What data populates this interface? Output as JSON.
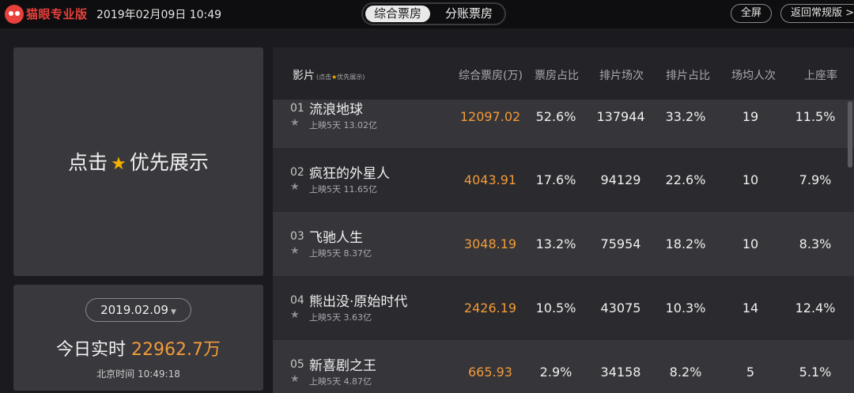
{
  "header": {
    "brand": "猫眼专业版",
    "datetime": "2019年02月09日 10:49",
    "tabs": [
      "综合票房",
      "分账票房"
    ],
    "fullscreen_label": "全屏",
    "return_label": "返回常规版 >"
  },
  "promo": {
    "text_before": "点击",
    "text_after": "优先展示"
  },
  "today": {
    "date": "2019.02.09",
    "label": "今日实时",
    "value": "22962.7万",
    "beijing_time": "北京时间 10:49:18"
  },
  "table": {
    "columns": {
      "film": "影片",
      "film_note_before": "(点击",
      "film_note_after": "优先展示)",
      "box_office": "综合票房(万)",
      "box_ratio": "票房占比",
      "shows": "排片场次",
      "show_ratio": "排片占比",
      "avg_people": "场均人次",
      "seat_rate": "上座率"
    },
    "rows": [
      {
        "rank": "01",
        "title": "流浪地球",
        "days": "上映5天",
        "total": "13.02亿",
        "box": "12097.02",
        "box_ratio": "52.6%",
        "shows": "137944",
        "show_ratio": "33.2%",
        "avg": "19",
        "seat": "11.5%"
      },
      {
        "rank": "02",
        "title": "疯狂的外星人",
        "days": "上映5天",
        "total": "11.65亿",
        "box": "4043.91",
        "box_ratio": "17.6%",
        "shows": "94129",
        "show_ratio": "22.6%",
        "avg": "10",
        "seat": "7.9%"
      },
      {
        "rank": "03",
        "title": "飞驰人生",
        "days": "上映5天",
        "total": "8.37亿",
        "box": "3048.19",
        "box_ratio": "13.2%",
        "shows": "75954",
        "show_ratio": "18.2%",
        "avg": "10",
        "seat": "8.3%"
      },
      {
        "rank": "04",
        "title": "熊出没·原始时代",
        "days": "上映5天",
        "total": "3.63亿",
        "box": "2426.19",
        "box_ratio": "10.5%",
        "shows": "43075",
        "show_ratio": "10.3%",
        "avg": "14",
        "seat": "12.4%"
      },
      {
        "rank": "05",
        "title": "新喜剧之王",
        "days": "上映5天",
        "total": "4.87亿",
        "box": "665.93",
        "box_ratio": "2.9%",
        "shows": "34158",
        "show_ratio": "8.2%",
        "avg": "5",
        "seat": "5.1%"
      }
    ]
  },
  "colors": {
    "brand": "#e8403c",
    "accent_orange": "#f29b38",
    "star": "#f5b300"
  },
  "icons": {
    "logo": "cat-eye-logo-icon",
    "star": "star-icon",
    "caret": "caret-down-icon"
  }
}
